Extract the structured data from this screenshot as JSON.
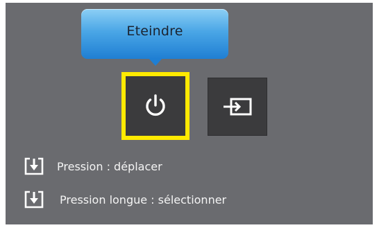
{
  "tooltip": {
    "label": "Eteindre"
  },
  "buttons": {
    "power": {
      "icon": "power-icon",
      "selected": true,
      "highlight_color": "#ffea00"
    },
    "input": {
      "icon": "source-input-icon",
      "selected": false
    }
  },
  "hints": [
    {
      "icon": "press-down-icon",
      "text": "Pression : déplacer"
    },
    {
      "icon": "press-down-icon",
      "text": "Pression longue : sélectionner"
    }
  ],
  "colors": {
    "panel_background": "#6a6b6f",
    "button_background": "#3b3b3d",
    "tooltip_gradient": [
      "#8ccff5",
      "#1f7fd3"
    ]
  }
}
